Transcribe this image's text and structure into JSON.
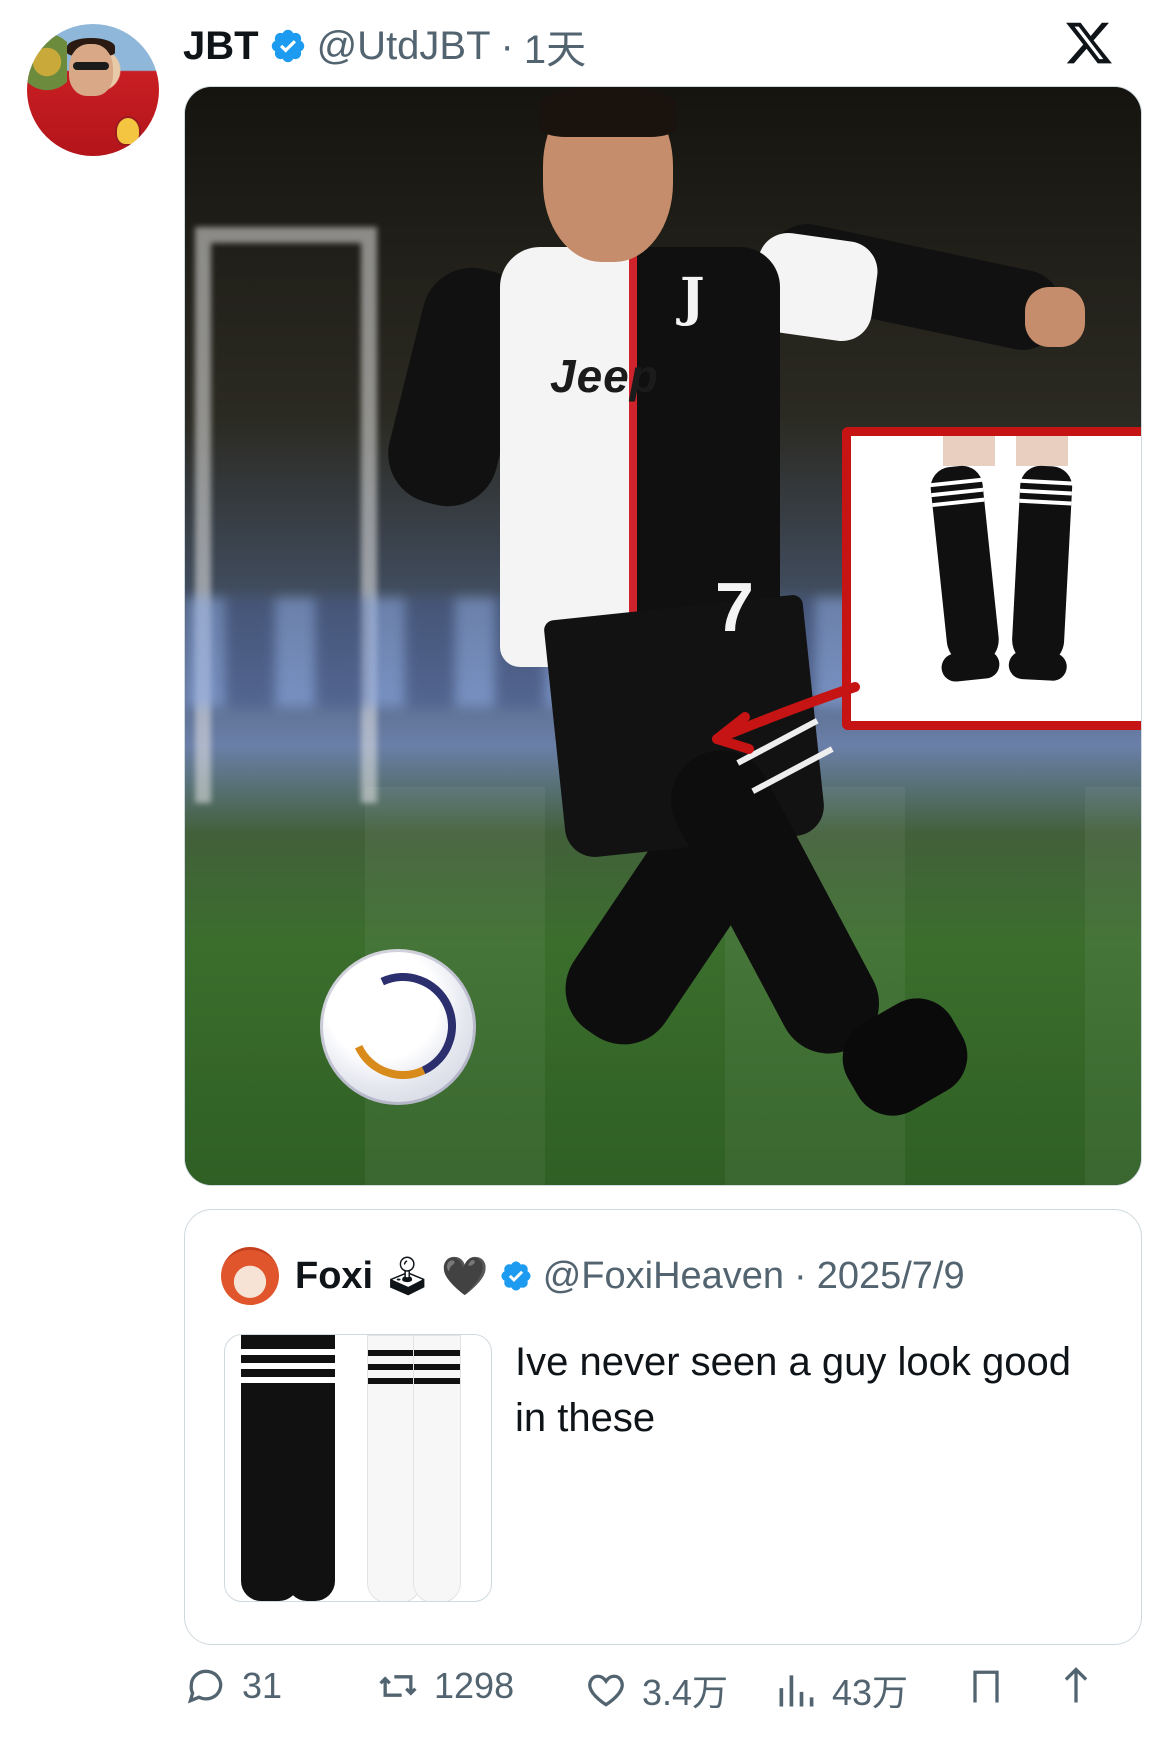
{
  "tweet": {
    "author_name": "JBT",
    "handle": "@UtdJBT",
    "separator": "·",
    "time": "1天"
  },
  "media": {
    "sponsor_text": "Jeep",
    "shirt_number": "7",
    "crest_letter": "J"
  },
  "quoted_tweet": {
    "author_name": "Foxi",
    "emoji_1": "🕹",
    "emoji_2": "🖤",
    "handle": "@FoxiHeaven",
    "separator": "·",
    "date": "2025/7/9",
    "text": "Ive never seen a guy look good in these"
  },
  "actions": {
    "replies": "31",
    "retweets": "1298",
    "likes": "3.4万",
    "views": "43万"
  },
  "icons": {
    "verified": "verified-badge-icon",
    "x_logo": "x-logo-icon",
    "reply": "reply-icon",
    "retweet": "retweet-icon",
    "like": "heart-icon",
    "views": "views-icon",
    "bookmark": "bookmark-icon",
    "share": "share-icon"
  },
  "colors": {
    "verified_blue": "#1d9bf0",
    "secondary_text": "#536471",
    "highlight_red": "#c61414"
  }
}
